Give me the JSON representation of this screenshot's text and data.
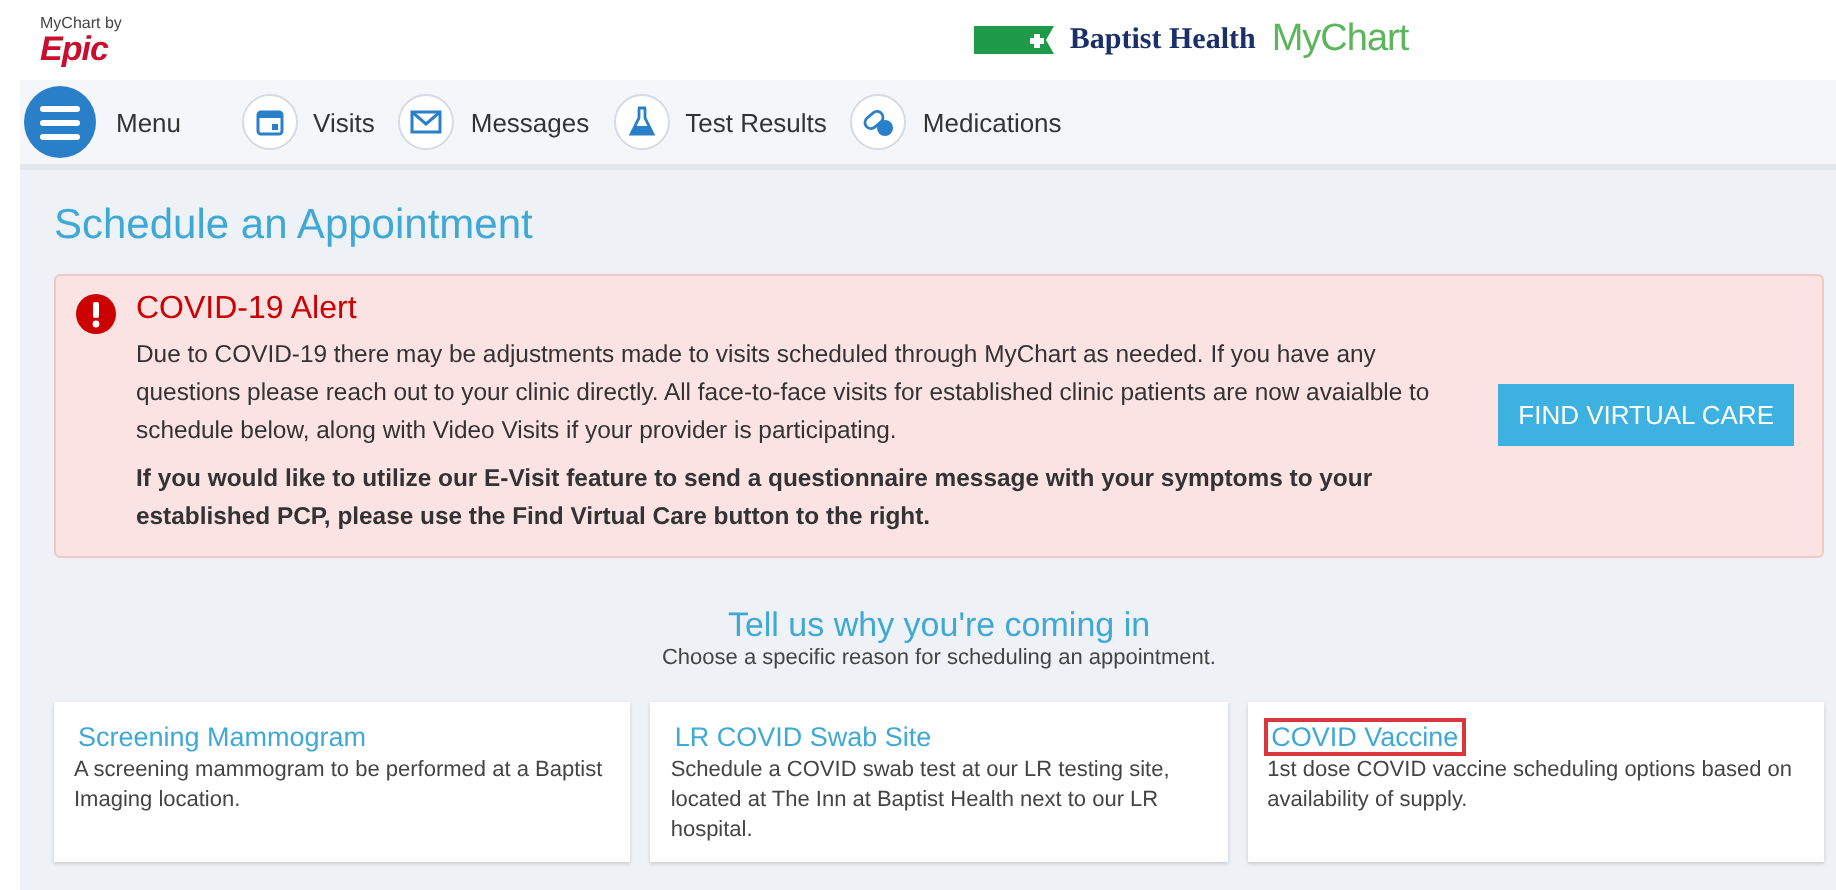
{
  "header": {
    "epic_logo": {
      "small": "MyChart by",
      "brand": "Epic"
    },
    "partner_logo": {
      "name": "Baptist Health",
      "product": "MyChart"
    }
  },
  "nav": {
    "menu": "Menu",
    "items": [
      {
        "label": "Visits"
      },
      {
        "label": "Messages"
      },
      {
        "label": "Test Results"
      },
      {
        "label": "Medications"
      }
    ]
  },
  "page_title": "Schedule an Appointment",
  "alert": {
    "title": "COVID-19 Alert",
    "message": "Due to COVID-19 there may be adjustments made to visits scheduled through MyChart as needed. If you have any questions please reach out to your clinic directly. All face-to-face visits for established clinic patients are now avaialble to schedule below, along with Video Visits if your provider is participating.",
    "note": "If you would like to utilize our E-Visit feature to send a questionnaire message with your symptoms to your established PCP, please use the Find Virtual Care button to the right.",
    "button": "FIND VIRTUAL CARE"
  },
  "reasons": {
    "title": "Tell us why you're coming in",
    "subtitle": "Choose a specific reason for scheduling an appointment.",
    "cards": [
      {
        "title": "Screening Mammogram",
        "description": "A screening mammogram to be performed at a Baptist Imaging location.",
        "highlighted": false
      },
      {
        "title": "LR COVID Swab Site",
        "description": "Schedule a COVID swab test at our LR testing site, located at The Inn at Baptist Health next to our LR hospital.",
        "highlighted": false
      },
      {
        "title": "COVID Vaccine",
        "description": "1st dose COVID vaccine scheduling options based on availability of supply.",
        "highlighted": true
      }
    ]
  }
}
